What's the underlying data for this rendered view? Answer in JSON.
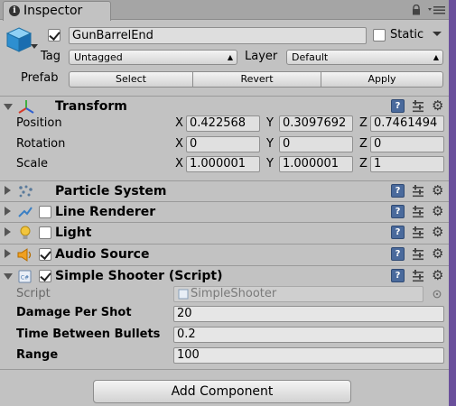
{
  "tab": {
    "title": "Inspector"
  },
  "header": {
    "object_name": "GunBarrelEnd",
    "static_label": "Static",
    "tag_label": "Tag",
    "tag_value": "Untagged",
    "layer_label": "Layer",
    "layer_value": "Default",
    "prefab_label": "Prefab",
    "prefab_buttons": [
      "Select",
      "Revert",
      "Apply"
    ]
  },
  "transform": {
    "title": "Transform",
    "position_label": "Position",
    "rotation_label": "Rotation",
    "scale_label": "Scale",
    "axes": [
      "X",
      "Y",
      "Z"
    ],
    "position": [
      "0.422568",
      "0.3097692",
      "0.7461494"
    ],
    "rotation": [
      "0",
      "0",
      "0"
    ],
    "scale": [
      "1.000001",
      "1.000001",
      "1"
    ]
  },
  "components": [
    {
      "title": "Particle System",
      "has_checkbox": false,
      "checked": false
    },
    {
      "title": "Line Renderer",
      "has_checkbox": true,
      "checked": false
    },
    {
      "title": "Light",
      "has_checkbox": true,
      "checked": false
    },
    {
      "title": "Audio Source",
      "has_checkbox": true,
      "checked": true
    },
    {
      "title": "Simple Shooter (Script)",
      "has_checkbox": true,
      "checked": true
    }
  ],
  "script_component": {
    "script_label": "Script",
    "script_value": "SimpleShooter",
    "fields": [
      {
        "label": "Damage Per Shot",
        "value": "20"
      },
      {
        "label": "Time Between Bullets",
        "value": "0.2"
      },
      {
        "label": "Range",
        "value": "100"
      }
    ]
  },
  "add_component_label": "Add Component",
  "colors": {
    "accent_bar": "#6a4f9b",
    "help_icon": "#4a6a9c",
    "panel": "#c2c2c2"
  }
}
